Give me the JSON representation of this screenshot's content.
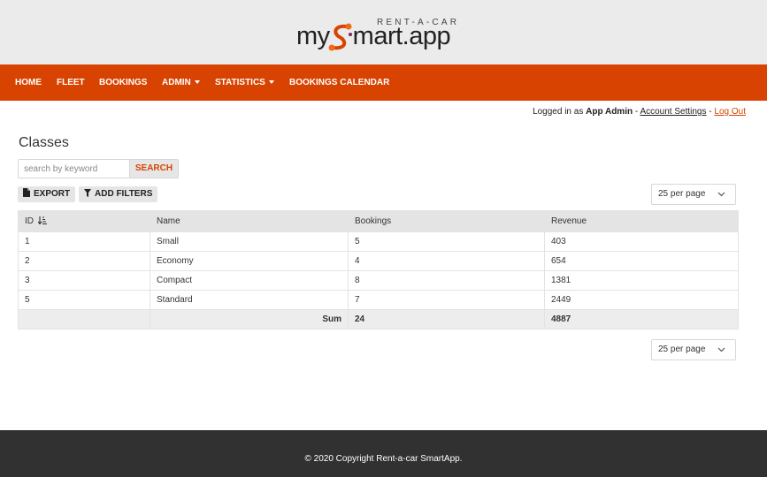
{
  "brand": {
    "tagline": "RENT-A-CAR",
    "word_before": "my",
    "word_after": "mart.app",
    "accent": "#d84301"
  },
  "nav": {
    "items": [
      {
        "label": "HOME"
      },
      {
        "label": "FLEET"
      },
      {
        "label": "BOOKINGS"
      },
      {
        "label": "ADMIN"
      },
      {
        "label": "STATISTICS"
      },
      {
        "label": "BOOKINGS CALENDAR"
      }
    ]
  },
  "user": {
    "prefix": "Logged in as",
    "name": "App Admin",
    "sep1": "-",
    "account_settings": "Account Settings",
    "sep2": "-",
    "logout": "Log Out"
  },
  "page": {
    "title": "Classes"
  },
  "search": {
    "placeholder": "search by keyword",
    "button": "SEARCH"
  },
  "toolbar": {
    "export": "EXPORT",
    "filters": "ADD FILTERS"
  },
  "pagination": {
    "per_page": "25 per page"
  },
  "table": {
    "headers": [
      "ID",
      "Name",
      "Bookings",
      "Revenue"
    ],
    "rows": [
      [
        "1",
        "Small",
        "5",
        "403"
      ],
      [
        "2",
        "Economy",
        "4",
        "654"
      ],
      [
        "3",
        "Compact",
        "8",
        "1381"
      ],
      [
        "5",
        "Standard",
        "7",
        "2449"
      ]
    ],
    "footer": {
      "label": "Sum",
      "bookings": "24",
      "revenue": "4887"
    }
  },
  "footer": {
    "text": "© 2020 Copyright Rent-a-car SmartApp."
  }
}
